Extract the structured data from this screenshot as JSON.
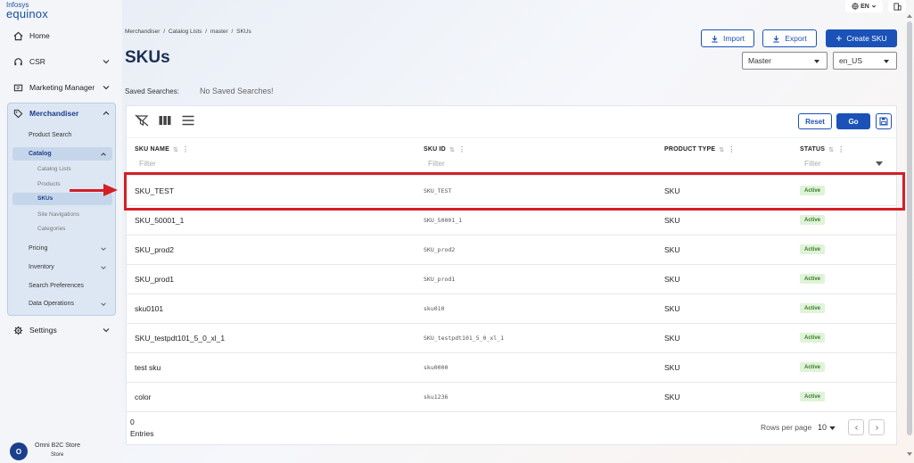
{
  "brand": {
    "line1": "Infosys",
    "line2": "equinox"
  },
  "topbar": {
    "language": "EN"
  },
  "sidebar": {
    "home": "Home",
    "csr": "CSR",
    "marketing": "Marketing Manager",
    "merchandiser": "Merchandiser",
    "product_search": "Product Search",
    "catalog": "Catalog",
    "catalog_lists": "Catalog Lists",
    "products": "Products",
    "skus": "SKUs",
    "site_navigations": "Site Navigations",
    "categories": "Categories",
    "pricing": "Pricing",
    "inventory": "Inventory",
    "search_preferences": "Search Preferences",
    "data_operations": "Data Operations",
    "settings": "Settings",
    "store_initial": "O",
    "store_name": "Omni B2C Store",
    "store_sub": "Store"
  },
  "breadcrumb": [
    "Merchandiser",
    "/",
    "Catalog Lists",
    "/",
    "master",
    "/",
    "SKUs"
  ],
  "page": {
    "title": "SKUs",
    "import_label": "Import",
    "export_label": "Export",
    "create_label": "Create SKU",
    "catalog_select": "Master",
    "locale_select": "en_US",
    "saved_searches_label": "Saved Searches:",
    "saved_searches_value": "No Saved Searches!"
  },
  "table": {
    "reset_label": "Reset",
    "go_label": "Go",
    "columns": [
      "SKU NAME",
      "SKU ID",
      "PRODUCT TYPE",
      "STATUS"
    ],
    "filter_placeholder": "Filter",
    "rows": [
      {
        "name": "SKU_TEST",
        "id": "SKU_TEST",
        "type": "SKU",
        "status": "Active"
      },
      {
        "name": "SKU_50001_1",
        "id": "SKU_50001_1",
        "type": "SKU",
        "status": "Active"
      },
      {
        "name": "SKU_prod2",
        "id": "SKU_prod2",
        "type": "SKU",
        "status": "Active"
      },
      {
        "name": "SKU_prod1",
        "id": "SKU_prod1",
        "type": "SKU",
        "status": "Active"
      },
      {
        "name": "sku0101",
        "id": "sku010",
        "type": "SKU",
        "status": "Active"
      },
      {
        "name": "SKU_testpdt101_5_0_xl_1",
        "id": "SKU_testpdt101_5_0_xl_1",
        "type": "SKU",
        "status": "Active"
      },
      {
        "name": "test sku",
        "id": "sku0000",
        "type": "SKU",
        "status": "Active"
      },
      {
        "name": "color",
        "id": "sku1236",
        "type": "SKU",
        "status": "Active"
      }
    ],
    "entries_count": "0",
    "entries_label": "Entries",
    "rows_per_page_label": "Rows per page",
    "rows_per_page_value": "10"
  },
  "colors": {
    "primary": "#1b52b8",
    "highlight": "#d41f26",
    "active_badge": "#dff3d8"
  }
}
